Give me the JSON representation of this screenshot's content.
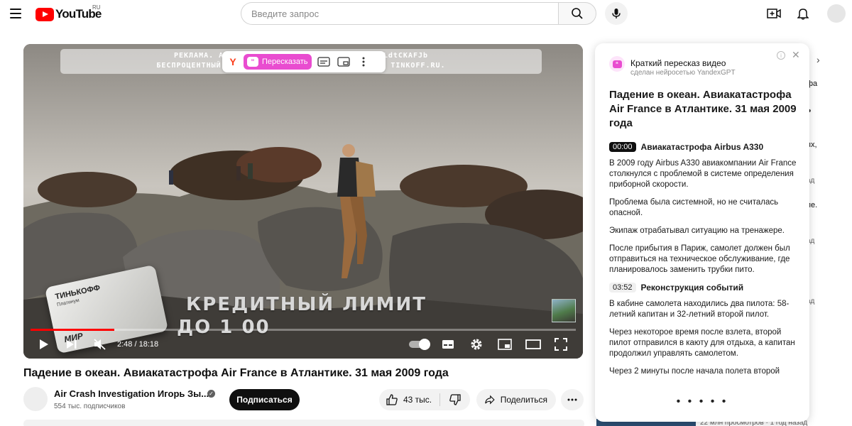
{
  "header": {
    "logo_text": "YouTube",
    "region": "RU",
    "search_placeholder": "Введите запрос"
  },
  "player": {
    "ad_line1": "РЕКЛАМА. АО \"ТИНЬКОФФ БА                                   РФ № 2673; erid: LdtCKAFJb",
    "ad_line2": "БЕСПРОЦЕНТНЫЙ ПЕРИОД НЕ РАСП                                   902. ПОДРОБНЕЕ НА TINKOFF.RU.",
    "retell_label": "Пересказать",
    "overlay_line1": "КРЕДИТНЫЙ ЛИМИТ",
    "overlay_line2": "ДО 1 00",
    "card_brand": "ТИНЬКОФФ",
    "card_tier": "Платинум",
    "card_network": "МИР",
    "time_current": "2:48",
    "time_total": "18:18",
    "progress": 0.153
  },
  "video": {
    "title": "Падение в океан. Авиакатастрофа Air France в Атлантике. 31 мая 2009 года",
    "channel_name": "Air Crash Investigation Игорь Зы...",
    "subscribers": "554 тыс. подписчиков",
    "subscribe_label": "Подписаться",
    "likes": "43 тыс.",
    "share_label": "Поделиться"
  },
  "summary": {
    "header": "Краткий пересказ видео",
    "subheader": "сделан нейросетью YandexGPT",
    "title": "Падение в океан. Авиакатастрофа Air France в Атлантике. 31 мая 2009 года",
    "sections": [
      {
        "time": "00:00",
        "heading": "Авиакатастрофа Airbus A330",
        "paragraphs": [
          "В 2009 году Airbus A330 авиакомпании Air France столкнулся с проблемой в системе определения приборной скорости.",
          "Проблема была системной, но не считалась опасной.",
          "Экипаж отрабатывал ситуацию на тренажере.",
          "После прибытия в Париж, самолет должен был отправиться на техническое обслуживание, где планировалось заменить трубки пито."
        ]
      },
      {
        "time": "03:52",
        "heading": "Реконструкция событий",
        "paragraphs": [
          "В кабине самолета находились два пилота: 58-летний капитан и 32-летний второй пилот.",
          "Через некоторое время после взлета, второй пилот отправился в каюту для отдыха, а капитан продолжил управлять самолетом.",
          "Через 2 минуты после начала полета второй"
        ]
      }
    ],
    "more_dots": "• • • • •"
  },
  "sidebar_peek": {
    "l1": "фа",
    "l2": "ях,",
    "l3": "ад",
    "l4": "пе.",
    "l5": "ад",
    "l6": "ад",
    "bottom": "22 млн просмотров · 1 год назад"
  },
  "colors": {
    "brand_red": "#ff0000",
    "retell_pink": "#e94cd0",
    "yandex_red": "#fc3f1d"
  }
}
